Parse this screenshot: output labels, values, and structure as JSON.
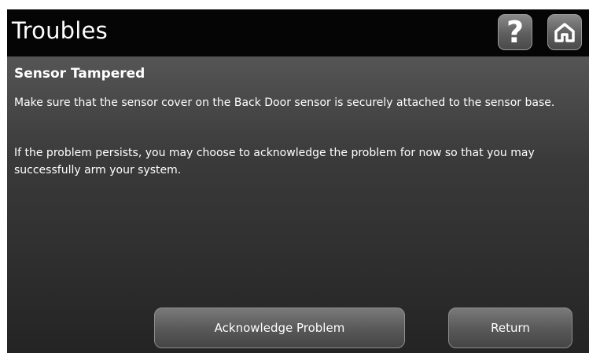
{
  "header": {
    "title": "Troubles",
    "help_icon": "question-mark-icon",
    "home_icon": "home-icon"
  },
  "trouble": {
    "title": "Sensor Tampered",
    "paragraph_1": "Make sure that the sensor cover on the Back Door sensor is securely attached to the sensor base.",
    "paragraph_2": "If the problem persists, you may choose to acknowledge the problem for now so that you may successfully arm your system."
  },
  "actions": {
    "acknowledge_label": "Acknowledge Problem",
    "return_label": "Return"
  },
  "colors": {
    "header_bg": "#050505",
    "text": "#ffffff",
    "button_gray": "#5a5a5a"
  }
}
